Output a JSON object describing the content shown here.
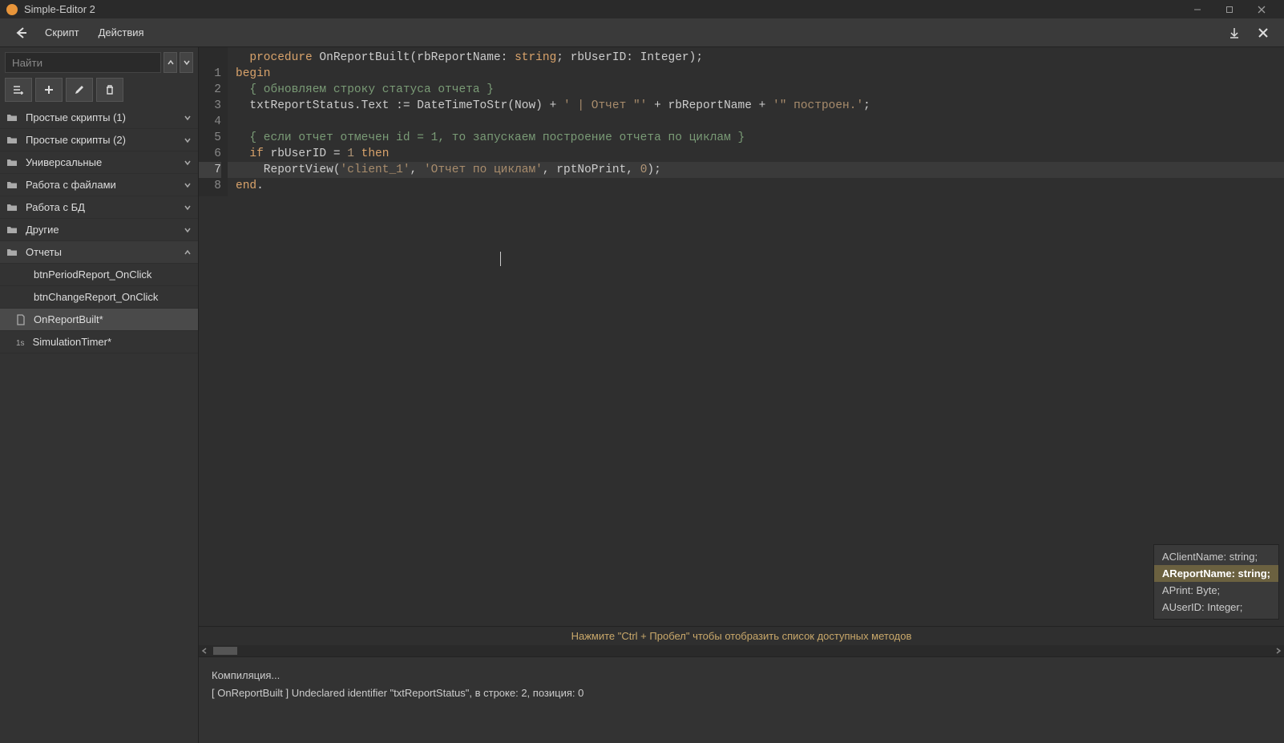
{
  "window": {
    "title": "Simple-Editor 2"
  },
  "menu": {
    "script": "Скрипт",
    "actions": "Действия"
  },
  "search": {
    "placeholder": "Найти"
  },
  "sidebar": {
    "folders": [
      {
        "label": "Простые скрипты (1)",
        "expanded": false
      },
      {
        "label": "Простые скрипты (2)",
        "expanded": false
      },
      {
        "label": "Универсальные",
        "expanded": false
      },
      {
        "label": "Работа с файлами",
        "expanded": false
      },
      {
        "label": "Работа с БД",
        "expanded": false
      },
      {
        "label": "Другие",
        "expanded": false
      },
      {
        "label": "Отчеты",
        "expanded": true
      }
    ],
    "items": [
      {
        "label": "btnPeriodReport_OnClick",
        "icon": "none"
      },
      {
        "label": "btnChangeReport_OnClick",
        "icon": "none"
      },
      {
        "label": "OnReportBuilt*",
        "icon": "file",
        "active": true
      },
      {
        "label": "SimulationTimer*",
        "icon": "timer"
      }
    ]
  },
  "code": {
    "lines": [
      {
        "n": "",
        "segs": [
          {
            "t": "  ",
            "c": "t"
          },
          {
            "t": "procedure",
            "c": "k"
          },
          {
            "t": " OnReportBuilt(rbReportName: ",
            "c": "t"
          },
          {
            "t": "string",
            "c": "k"
          },
          {
            "t": "; rbUserID: Integer);",
            "c": "t"
          }
        ]
      },
      {
        "n": "1",
        "segs": [
          {
            "t": "begin",
            "c": "k"
          }
        ]
      },
      {
        "n": "2",
        "segs": [
          {
            "t": "  ",
            "c": "t"
          },
          {
            "t": "{ обновляем строку статуса отчета }",
            "c": "c"
          }
        ]
      },
      {
        "n": "3",
        "segs": [
          {
            "t": "  txtReportStatus.Text := DateTimeToStr(Now) + ",
            "c": "t"
          },
          {
            "t": "' | Отчет \"'",
            "c": "s"
          },
          {
            "t": " + rbReportName + ",
            "c": "t"
          },
          {
            "t": "'\" построен.'",
            "c": "s"
          },
          {
            "t": ";",
            "c": "t"
          }
        ]
      },
      {
        "n": "4",
        "segs": [
          {
            "t": "",
            "c": "t"
          }
        ]
      },
      {
        "n": "5",
        "segs": [
          {
            "t": "  ",
            "c": "t"
          },
          {
            "t": "{ если отчет отмечен id = 1, то запускаем построение отчета по циклам }",
            "c": "c"
          }
        ]
      },
      {
        "n": "6",
        "segs": [
          {
            "t": "  ",
            "c": "t"
          },
          {
            "t": "if",
            "c": "k"
          },
          {
            "t": " rbUserID = ",
            "c": "t"
          },
          {
            "t": "1",
            "c": "n"
          },
          {
            "t": " ",
            "c": "t"
          },
          {
            "t": "then",
            "c": "k"
          }
        ]
      },
      {
        "n": "7",
        "hl": true,
        "segs": [
          {
            "t": "    ReportView(",
            "c": "t"
          },
          {
            "t": "'client_1'",
            "c": "s"
          },
          {
            "t": ", ",
            "c": "t"
          },
          {
            "t": "'Отчет по циклам'",
            "c": "s"
          },
          {
            "t": ", rptNoPrint, ",
            "c": "t"
          },
          {
            "t": "0",
            "c": "n"
          },
          {
            "t": ");",
            "c": "t"
          }
        ]
      },
      {
        "n": "8",
        "segs": [
          {
            "t": "end",
            "c": "k"
          },
          {
            "t": ".",
            "c": "t"
          }
        ]
      }
    ]
  },
  "hint": "Нажмите \"Ctrl + Пробел\" чтобы отобразить список доступных методов",
  "tooltip": {
    "rows": [
      {
        "label": "AClientName: string;",
        "sel": false
      },
      {
        "label": "AReportName: string;",
        "sel": true
      },
      {
        "label": "APrint: Byte;",
        "sel": false
      },
      {
        "label": "AUserID: Integer;",
        "sel": false
      }
    ]
  },
  "output": {
    "line1": "Компиляция...",
    "line2": "[ OnReportBuilt ] Undeclared identifier \"txtReportStatus\", в строке: 2, позиция: 0"
  }
}
